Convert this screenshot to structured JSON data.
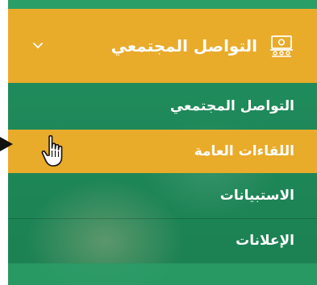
{
  "menu": {
    "header": {
      "title": "التواصل المجتمعي",
      "icon": "community-icon",
      "chevron": "chevron-down-icon"
    },
    "items": [
      {
        "label": "التواصل المجتمعي",
        "state": "normal"
      },
      {
        "label": "اللقاءات العامة",
        "state": "hover"
      },
      {
        "label": "الاستبيانات",
        "state": "normal"
      },
      {
        "label": "الإعلانات",
        "state": "normal"
      }
    ]
  },
  "colors": {
    "accent": "#e9ab2a",
    "menu_green": "#1e8a5a",
    "text": "#ffffff"
  },
  "pointer": {
    "icon": "hand-cursor-icon",
    "callout": "arrow-pointer-icon"
  }
}
